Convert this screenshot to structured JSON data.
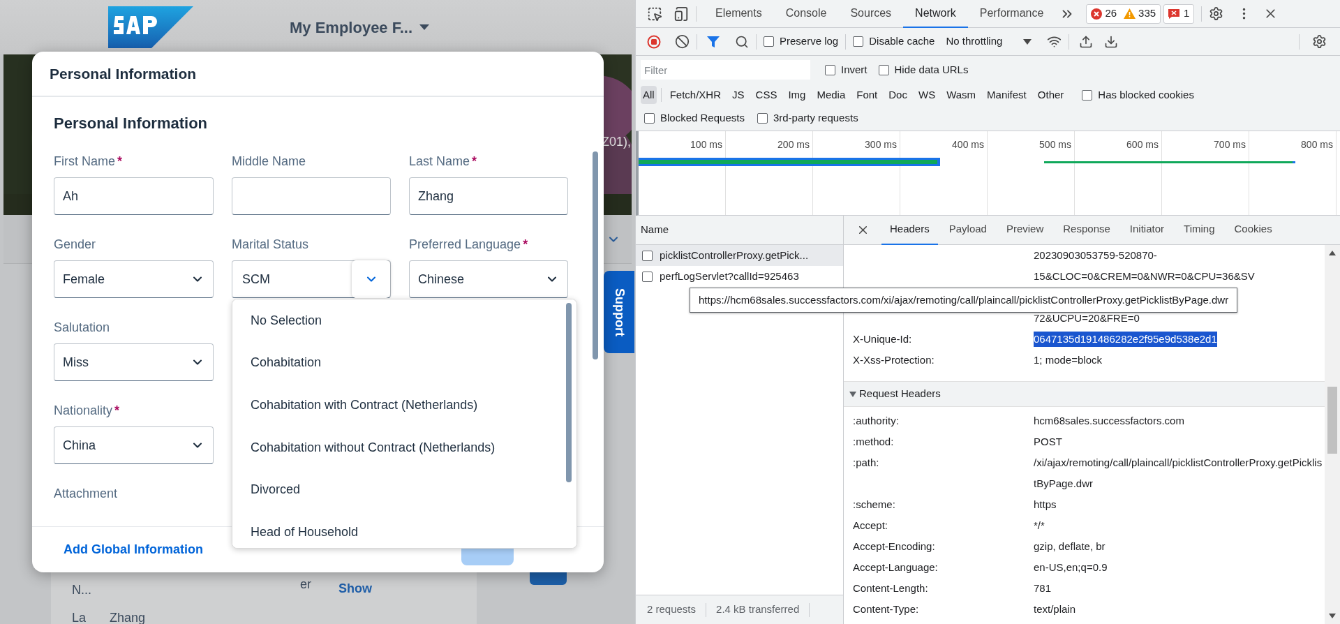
{
  "page": {
    "title": "My Employee F...",
    "banner_text": "Z01),",
    "support_tab": "Support",
    "profile_rows": [
      {
        "label": "N...",
        "trailing": "er",
        "link": "Show"
      },
      {
        "label": "La",
        "value": "Zhang"
      }
    ]
  },
  "dialog": {
    "title": "Personal Information",
    "section_title": "Personal Information",
    "rows": [
      [
        {
          "label": "First Name",
          "required_mark": "*",
          "kind": "input",
          "value": "Ah"
        },
        {
          "label": "Middle Name",
          "kind": "input"
        },
        {
          "label": "Last Name",
          "required_mark": "*",
          "kind": "input",
          "value": "Zhang"
        }
      ],
      [
        {
          "label": "Gender",
          "kind": "select",
          "value": "Female"
        },
        {
          "label": "Marital Status",
          "kind": "combo",
          "value": "SCM",
          "expanded": true,
          "options": [
            {
              "label": "No Selection",
              "selected": false
            },
            {
              "label": "Cohabitation",
              "selected": false
            },
            {
              "label": "Cohabitation with Contract (Netherlands)",
              "selected": false
            },
            {
              "label": "Cohabitation without Contract (Netherlands)",
              "selected": false
            },
            {
              "label": "Divorced",
              "selected": false
            },
            {
              "label": "Head of Household",
              "selected": false
            }
          ]
        },
        {
          "label": "Preferred Language",
          "required_mark": "*",
          "kind": "select",
          "value": "Chinese"
        }
      ],
      [
        {
          "label": "Salutation",
          "kind": "select",
          "value": "Miss"
        }
      ],
      [
        {
          "label": "Nationality",
          "required_mark": "*",
          "kind": "select",
          "value": "China"
        }
      ],
      [
        {
          "label": "Attachment",
          "kind": "label"
        }
      ]
    ],
    "footer": {
      "link": "Add Global Information",
      "save": {
        "disabled": true
      }
    }
  },
  "devtools": {
    "tabs": [
      {
        "label": "Elements",
        "selected": false
      },
      {
        "label": "Console",
        "selected": false
      },
      {
        "label": "Sources",
        "selected": false
      },
      {
        "label": "Network",
        "selected": true
      },
      {
        "label": "Performance",
        "selected": false
      }
    ],
    "counts": {
      "errors": "26",
      "warnings": "335",
      "issues": "1"
    },
    "toolbar": {
      "recording": true,
      "preserve_log": {
        "label": "Preserve log",
        "checked": false
      },
      "disable_cache": {
        "label": "Disable cache",
        "checked": false
      },
      "throttling": "No throttling"
    },
    "filter": {
      "placeholder": "Filter",
      "invert": {
        "label": "Invert",
        "checked": false
      },
      "hide_data_urls": {
        "label": "Hide data URLs",
        "checked": false
      }
    },
    "type_filters": [
      {
        "label": "All",
        "selected": true
      },
      {
        "label": "Fetch/XHR",
        "selected": false
      },
      {
        "label": "JS",
        "selected": false
      },
      {
        "label": "CSS",
        "selected": false
      },
      {
        "label": "Img",
        "selected": false
      },
      {
        "label": "Media",
        "selected": false
      },
      {
        "label": "Font",
        "selected": false
      },
      {
        "label": "Doc",
        "selected": false
      },
      {
        "label": "WS",
        "selected": false
      },
      {
        "label": "Wasm",
        "selected": false
      },
      {
        "label": "Manifest",
        "selected": false
      },
      {
        "label": "Other",
        "selected": false
      }
    ],
    "has_blocked_cookies": {
      "label": "Has blocked cookies",
      "checked": false
    },
    "blocked_requests": {
      "label": "Blocked Requests",
      "checked": false
    },
    "third_party_requests": {
      "label": "3rd-party requests",
      "checked": false
    },
    "timeline": {
      "ticks": [
        "100 ms",
        "200 ms",
        "300 ms",
        "400 ms",
        "500 ms",
        "600 ms",
        "700 ms",
        "800 ms"
      ]
    },
    "requests": {
      "column": "Name",
      "rows": [
        {
          "name": "picklistControllerProxy.getPick...",
          "selected": true
        },
        {
          "name": "perfLogServlet?callId=925463",
          "selected": false
        }
      ],
      "summary": [
        "2 requests",
        "2.4 kB transferred"
      ]
    },
    "tooltip": "https://hcm68sales.successfactors.com/xi/ajax/remoting/call/plaincall/picklistControllerProxy.getPicklistByPage.dwr",
    "detail": {
      "tabs": [
        {
          "label": "Headers",
          "selected": true
        },
        {
          "label": "Payload",
          "selected": false
        },
        {
          "label": "Preview",
          "selected": false
        },
        {
          "label": "Response",
          "selected": false
        },
        {
          "label": "Initiator",
          "selected": false
        },
        {
          "label": "Timing",
          "selected": false
        },
        {
          "label": "Cookies",
          "selected": false
        }
      ],
      "value_lines_above_tooltip": [
        "20230903053759-520870-",
        "15&CLOC=0&CREM=0&NWR=0&CPU=36&SV"
      ],
      "value_lines_below_tooltip": [
        "72&UCPU=20&FRE=0"
      ],
      "response_headers": [
        {
          "name": "X-Unique-Id:",
          "value": "0647135d191486282e2f95e9d538e2d1",
          "selected": true
        },
        {
          "name": "X-Xss-Protection:",
          "value": "1; mode=block",
          "selected": false
        }
      ],
      "request_headers": {
        "title": "Request Headers",
        "expanded": true,
        "rows": [
          {
            "name": ":authority:",
            "value": "hcm68sales.successfactors.com"
          },
          {
            "name": ":method:",
            "value": "POST"
          },
          {
            "name": ":path:",
            "value": "/xi/ajax/remoting/call/plaincall/picklistControllerProxy.getPicklistByPage.dwr"
          },
          {
            "name": ":scheme:",
            "value": "https"
          },
          {
            "name": "Accept:",
            "value": "*/*"
          },
          {
            "name": "Accept-Encoding:",
            "value": "gzip, deflate, br"
          },
          {
            "name": "Accept-Language:",
            "value": "en-US,en;q=0.9"
          },
          {
            "name": "Content-Length:",
            "value": "781"
          },
          {
            "name": "Content-Type:",
            "value": "text/plain"
          }
        ]
      }
    }
  }
}
